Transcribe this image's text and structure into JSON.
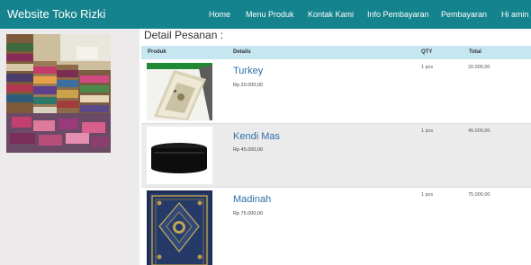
{
  "brand": "Website Toko Rizki",
  "nav": [
    "Home",
    "Menu Produk",
    "Kontak Kami",
    "Info Pembayaran",
    "Pembayaran",
    "Hi amin"
  ],
  "page_title": "Detail Pesanan :",
  "table": {
    "headers": [
      "Produk",
      "Details",
      "QTY",
      "Total"
    ],
    "rows": [
      {
        "name": "Turkey",
        "price": "Rp 20.000,00",
        "qty": "1 pcs",
        "total": "20.000,00"
      },
      {
        "name": "Kendi Mas",
        "price": "Rp 45.000,00",
        "qty": "1 pcs",
        "total": "45.000,00"
      },
      {
        "name": "Madinah",
        "price": "Rp 75.000,00",
        "qty": "1 pcs",
        "total": "75.000,00"
      }
    ]
  }
}
